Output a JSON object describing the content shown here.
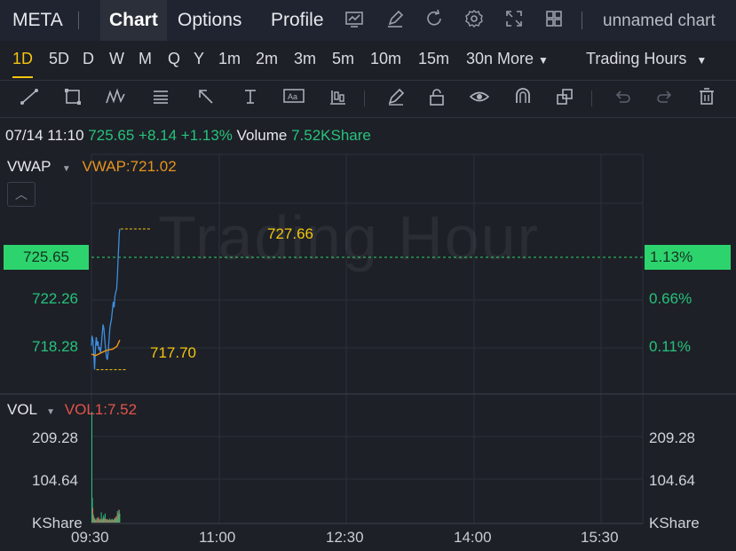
{
  "header": {
    "symbol": "META",
    "tabs": [
      "Chart",
      "Options",
      "Profile"
    ],
    "chart_name": "unnamed chart"
  },
  "icons": [
    "screenshot-icon",
    "edit-icon",
    "refresh-icon",
    "settings-icon",
    "fullscreen-icon",
    "layout-grid-icon"
  ],
  "periods": [
    "1D",
    "5D",
    "D",
    "W",
    "M",
    "Q",
    "Y",
    "1m",
    "2m",
    "3m",
    "5m",
    "10m",
    "15m",
    "30n"
  ],
  "active_period": "1D",
  "more_label": "More",
  "session_label": "Trading Hours",
  "tools": [
    "trend-line-icon",
    "rectangle-icon",
    "pattern-icon",
    "fib-icon",
    "arrow-icon",
    "text-icon",
    "note-icon",
    "indicator-icon",
    "pen-icon",
    "lock-icon",
    "eye-icon",
    "magnet-icon",
    "clone-icon",
    "undo-icon",
    "redo-icon",
    "trash-icon"
  ],
  "quote": {
    "time": "07/14 11:10",
    "price": "725.65",
    "change": "+8.14",
    "change_pct": "+1.13%",
    "volume_label": "Volume",
    "volume": "7.52KShare"
  },
  "indicator": {
    "name": "VWAP",
    "value_text": "VWAP:721.02"
  },
  "watermark": "Trading Hour",
  "vol_indicator": {
    "name": "VOL",
    "value_text": "VOL1:7.52"
  },
  "colors": {
    "price_line": "#3d8fe0",
    "vwap_line": "#e7931f",
    "up": "#27c27c",
    "down": "#e5534b",
    "accent": "#2dd46e"
  },
  "chart_data": [
    {
      "type": "line",
      "title": "",
      "x_ticks": [
        "09:30",
        "11:00",
        "12:30",
        "14:00",
        "15:30"
      ],
      "y_ticks_left": [
        "725.65",
        "722.26",
        "718.28"
      ],
      "y_ticks_right": [
        "1.13%",
        "0.66%",
        "0.11%"
      ],
      "ylim": [
        716.8,
        729.0
      ],
      "current_price": 725.65,
      "annotations": {
        "high": "727.66",
        "low": "717.70"
      },
      "series": [
        {
          "name": "Price",
          "x": [
            "09:30",
            "09:32",
            "09:35",
            "09:38",
            "09:41",
            "09:44",
            "09:47",
            "09:50",
            "09:53",
            "09:56",
            "09:59",
            "10:02",
            "10:05",
            "10:08",
            "10:11",
            "10:14",
            "10:17",
            "10:20",
            "10:23",
            "10:26",
            "10:29",
            "10:32",
            "10:35",
            "10:38",
            "10:41",
            "10:44",
            "10:47",
            "10:50",
            "10:53",
            "10:56",
            "10:59",
            "11:02",
            "11:05",
            "11:08",
            "11:10"
          ],
          "values": [
            719.4,
            720.1,
            719.8,
            718.9,
            717.7,
            719.2,
            720.0,
            719.4,
            719.7,
            719.1,
            719.3,
            718.9,
            719.5,
            720.2,
            720.9,
            720.6,
            719.8,
            719.2,
            718.6,
            718.4,
            718.9,
            719.8,
            720.6,
            721.0,
            721.3,
            721.9,
            722.5,
            722.1,
            722.9,
            723.2,
            723.4,
            724.4,
            725.9,
            727.3,
            727.66
          ]
        },
        {
          "name": "VWAP",
          "x": [
            "09:30",
            "09:45",
            "10:00",
            "10:15",
            "10:30",
            "10:45",
            "11:00",
            "11:10"
          ],
          "values": [
            718.8,
            718.7,
            718.85,
            719.0,
            719.1,
            719.15,
            719.35,
            719.8
          ]
        }
      ]
    },
    {
      "type": "bar",
      "title": "",
      "y_ticks": [
        "209.28",
        "104.64"
      ],
      "unit_label": "KShare",
      "ylim": [
        0,
        270
      ],
      "volumes": [
        270,
        60,
        35,
        20,
        15,
        12,
        10,
        8,
        6,
        5,
        9,
        12,
        7,
        10,
        14,
        8,
        10,
        6,
        5,
        9,
        25,
        8,
        6,
        10,
        12,
        18,
        8,
        11,
        22,
        9,
        8,
        6,
        8,
        9,
        6,
        5,
        7,
        6,
        10,
        7,
        5,
        8,
        6,
        9,
        7,
        6,
        6,
        8,
        10,
        12,
        9,
        14,
        16,
        10,
        28,
        24,
        20,
        32,
        30,
        22
      ],
      "directions": [
        1,
        1,
        0,
        1,
        0,
        1,
        0,
        1,
        1,
        0,
        0,
        1,
        0,
        1,
        0,
        1,
        0,
        1,
        0,
        0,
        1,
        1,
        0,
        1,
        0,
        1,
        1,
        0,
        1,
        0,
        0,
        1,
        0,
        1,
        0,
        1,
        1,
        0,
        1,
        0,
        1,
        0,
        1,
        1,
        0,
        1,
        0,
        1,
        1,
        0,
        1,
        1,
        0,
        1,
        1,
        0,
        1,
        0,
        1,
        1
      ]
    }
  ]
}
